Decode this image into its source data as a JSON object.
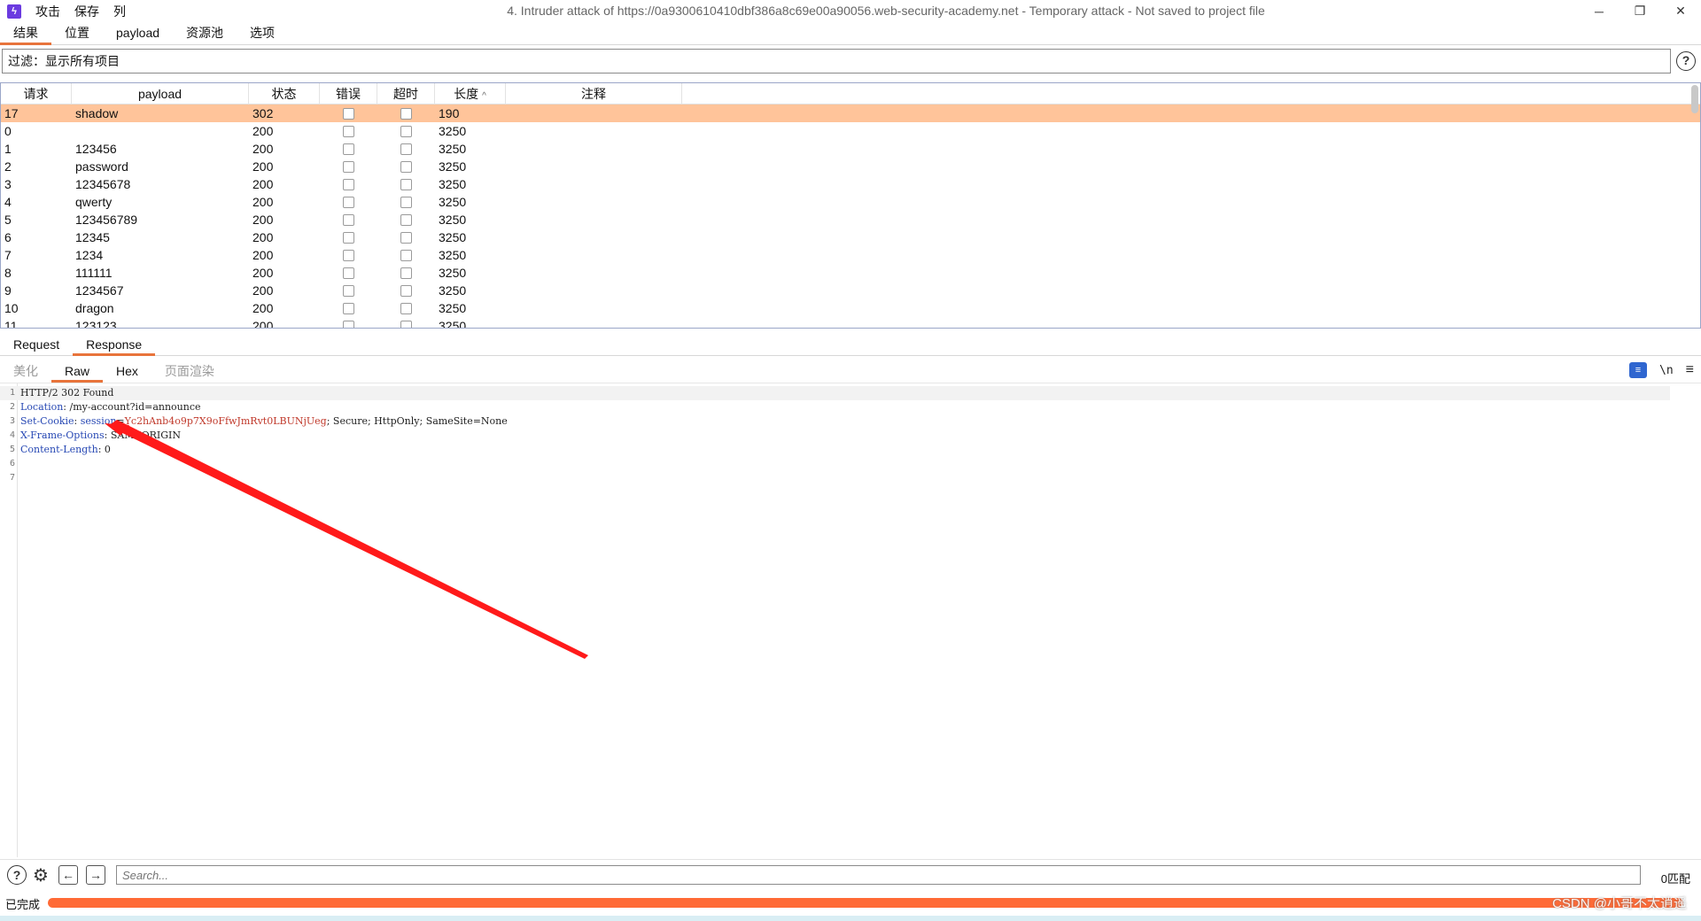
{
  "window": {
    "title": "4. Intruder attack of https://0a9300610410dbf386a8c69e00a90056.web-security-academy.net - Temporary attack - Not saved to project file",
    "menu": [
      "攻击",
      "保存",
      "列"
    ],
    "logo_glyph": "ϟ",
    "controls": {
      "minimize": "─",
      "restore": "❐",
      "close": "✕"
    }
  },
  "main_tabs": [
    "结果",
    "位置",
    "payload",
    "资源池",
    "选项"
  ],
  "filter": {
    "text": "过滤：显示所有项目",
    "help": "?"
  },
  "table": {
    "columns": [
      "请求",
      "payload",
      "状态",
      "错误",
      "超时",
      "长度",
      "注释"
    ],
    "sort_indicator": "^",
    "rows": [
      {
        "req": "17",
        "payload": "shadow",
        "status": "302",
        "len": "190",
        "selected": true
      },
      {
        "req": "0",
        "payload": "",
        "status": "200",
        "len": "3250"
      },
      {
        "req": "1",
        "payload": "123456",
        "status": "200",
        "len": "3250"
      },
      {
        "req": "2",
        "payload": "password",
        "status": "200",
        "len": "3250"
      },
      {
        "req": "3",
        "payload": "12345678",
        "status": "200",
        "len": "3250"
      },
      {
        "req": "4",
        "payload": "qwerty",
        "status": "200",
        "len": "3250"
      },
      {
        "req": "5",
        "payload": "123456789",
        "status": "200",
        "len": "3250"
      },
      {
        "req": "6",
        "payload": "12345",
        "status": "200",
        "len": "3250"
      },
      {
        "req": "7",
        "payload": "1234",
        "status": "200",
        "len": "3250"
      },
      {
        "req": "8",
        "payload": "111111",
        "status": "200",
        "len": "3250"
      },
      {
        "req": "9",
        "payload": "1234567",
        "status": "200",
        "len": "3250"
      },
      {
        "req": "10",
        "payload": "dragon",
        "status": "200",
        "len": "3250"
      },
      {
        "req": "11",
        "payload": "123123",
        "status": "200",
        "len": "3250"
      }
    ]
  },
  "rr_tabs": [
    "Request",
    "Response"
  ],
  "view_tabs": [
    "美化",
    "Raw",
    "Hex",
    "页面渲染"
  ],
  "view_icons": {
    "wrap": "≡",
    "newline": "\\n",
    "menu": "≡"
  },
  "response_lines": [
    {
      "num": "1",
      "parts": [
        {
          "t": "HTTP/2 302 Found",
          "c": "v"
        }
      ]
    },
    {
      "num": "2",
      "parts": [
        {
          "t": "Location",
          "c": "k"
        },
        {
          "t": ": /my-account?id=announce",
          "c": "v"
        }
      ]
    },
    {
      "num": "3",
      "parts": [
        {
          "t": "Set-Cookie",
          "c": "k"
        },
        {
          "t": ": ",
          "c": "v"
        },
        {
          "t": "session",
          "c": "ck"
        },
        {
          "t": "=",
          "c": "v"
        },
        {
          "t": "Yc2hAnb4o9p7X9oFfwJmRvt0LBUNjUeg",
          "c": "cv"
        },
        {
          "t": "; Secure; HttpOnly; SameSite=None",
          "c": "v"
        }
      ]
    },
    {
      "num": "4",
      "parts": [
        {
          "t": "X-Frame-Options",
          "c": "k"
        },
        {
          "t": ": SAMEORIGIN",
          "c": "v"
        }
      ]
    },
    {
      "num": "5",
      "parts": [
        {
          "t": "Content-Length",
          "c": "k"
        },
        {
          "t": ": 0",
          "c": "v"
        }
      ]
    },
    {
      "num": "6",
      "parts": []
    },
    {
      "num": "7",
      "parts": []
    }
  ],
  "search": {
    "placeholder": "Search...",
    "match_count": "0匹配"
  },
  "status": {
    "text": "已完成",
    "progress_fraction": 1.0
  },
  "watermark": "CSDN @小哥不太逍遥",
  "colors": {
    "accent": "#e8743b",
    "selected_row": "#ffc49a",
    "progress": "#ff6a36",
    "arrow": "#ff1a1a"
  }
}
